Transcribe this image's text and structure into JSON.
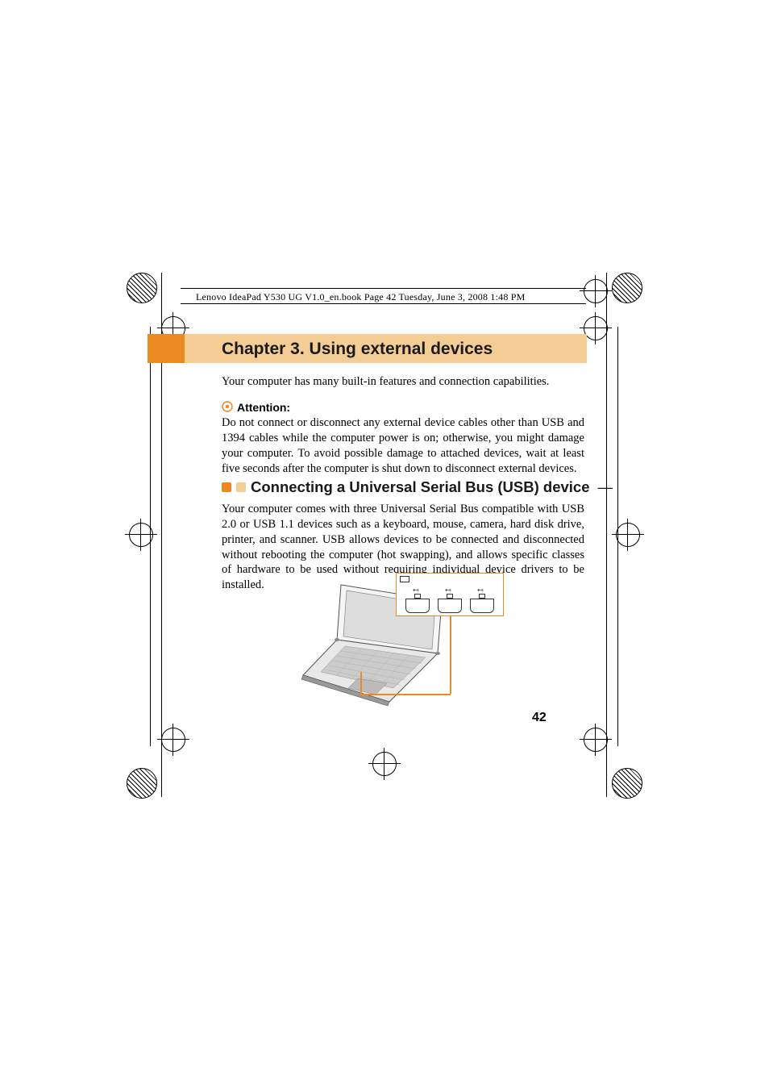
{
  "book_header": "Lenovo IdeaPad Y530 UG V1.0_en.book  Page 42  Tuesday, June 3, 2008  1:48 PM",
  "chapter": {
    "title": "Chapter 3. Using external devices"
  },
  "intro_text": "Your computer has many built-in features and connection capabilities.",
  "attention": {
    "label": "Attention:",
    "body": "Do not connect or disconnect any external device cables other than USB and 1394 cables while the computer power is on; otherwise, you might damage your computer. To avoid possible damage to attached devices, wait at least five seconds after the computer is shut down to disconnect external devices."
  },
  "section": {
    "title": "Connecting a Universal Serial Bus (USB) device",
    "body": "Your computer comes with three Universal Serial Bus compatible with USB 2.0 or USB 1.1 devices such as a keyboard, mouse, camera, hard disk drive, printer, and scanner. USB allows devices to be connected and disconnected without rebooting the computer (hot swapping), and allows specific classes of hardware to be used without requiring individual device drivers to be installed."
  },
  "page_number": "42",
  "colors": {
    "banner_dark": "#ec8a22",
    "banner_light": "#f4cd95"
  }
}
